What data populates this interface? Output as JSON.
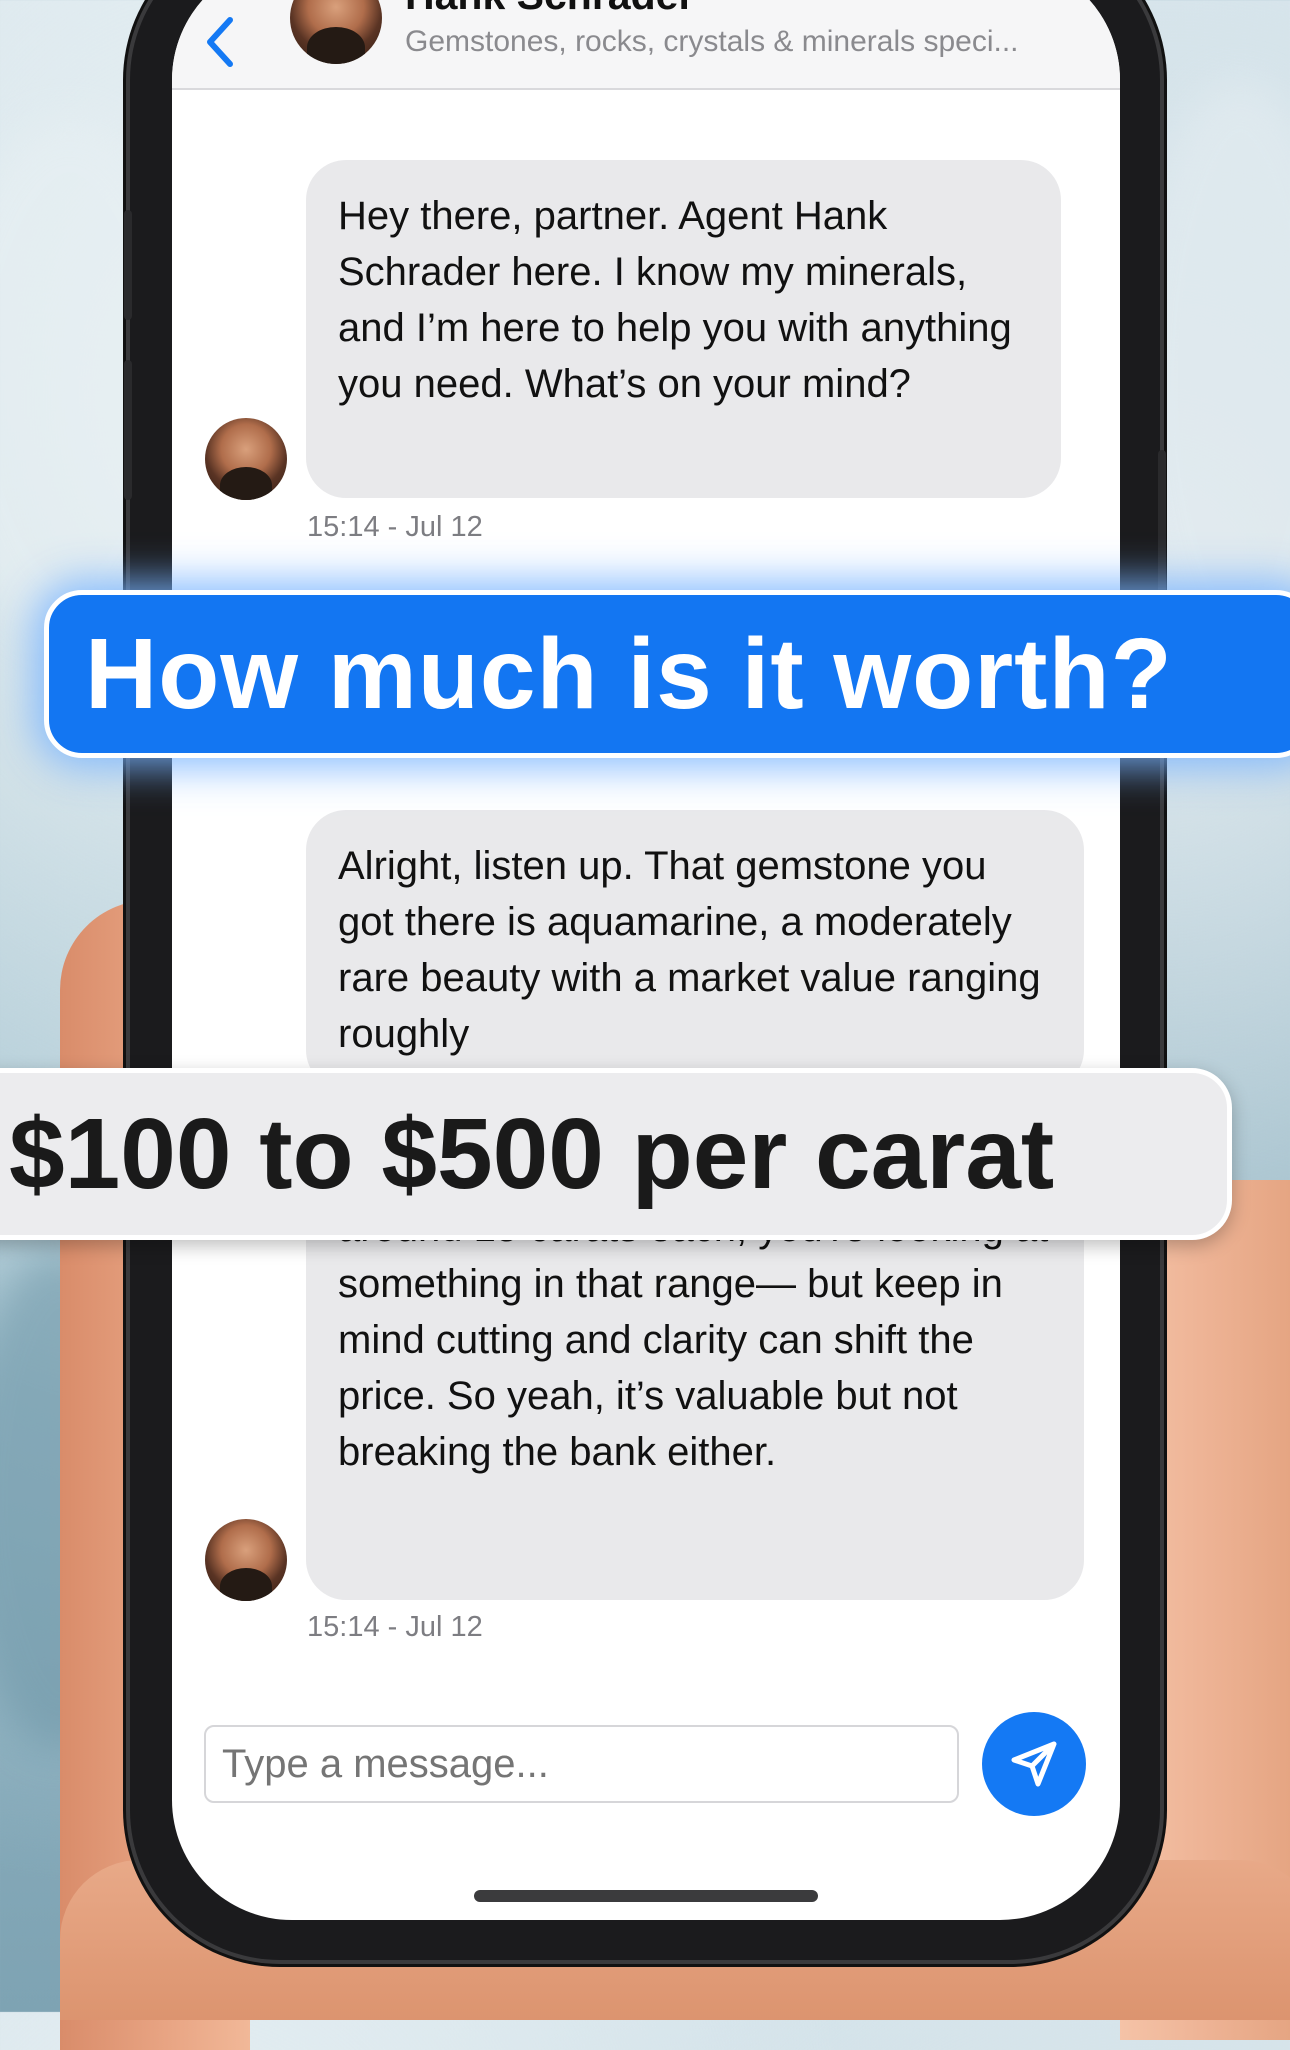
{
  "header": {
    "name": "Hank Schrader",
    "subtitle": "Gemstones, rocks, crystals & minerals speci..."
  },
  "messages": [
    {
      "text": "Hey there, partner. Agent Hank Schrader here. I know my minerals, and I’m here to help you with anything you need. What’s on your mind?",
      "timestamp": "15:14 - Jul 12"
    },
    {
      "text_top": "Alright, listen up. That gemstone you got there is aquamarine, a moderately rare beauty with a market value ranging roughly",
      "text_bottom": "around 15 carats each, you're looking at something in that range— but keep in mind cutting and clarity can shift the price. So yeah, it’s valuable but not breaking the bank either.",
      "timestamp": "15:14 - Jul 12"
    }
  ],
  "input": {
    "placeholder": "Type a message..."
  },
  "overlays": {
    "question": "How much is it worth?",
    "price": "$100 to $500 per carat"
  },
  "colors": {
    "accent": "#1479f4",
    "bubble": "#e9e9eb"
  },
  "icons": {
    "back": "chevron-left-icon",
    "send": "send-icon"
  }
}
